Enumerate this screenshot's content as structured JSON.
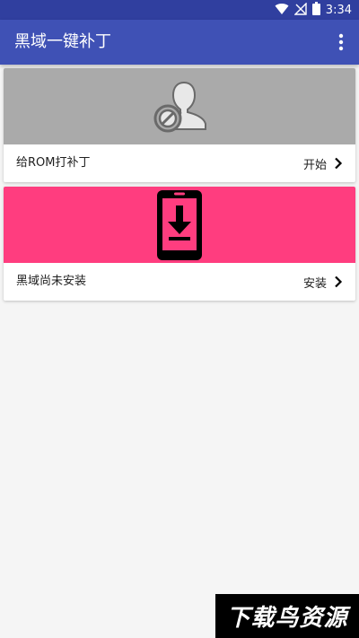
{
  "status_bar": {
    "time": "3:34",
    "icons": [
      "wifi-icon",
      "no-signal-icon",
      "battery-icon"
    ]
  },
  "app_bar": {
    "title": "黑域一键补丁",
    "menu_icon": "more-vert-icon"
  },
  "cards": [
    {
      "banner_color": "#aaaaaa",
      "banner_icon": "user-blocked-icon",
      "label": "给ROM打补丁",
      "action": "开始",
      "action_icon": "chevron-right-icon"
    },
    {
      "banner_color": "#ff3d7f",
      "banner_icon": "phone-download-icon",
      "label": "黑域尚未安装",
      "action": "安装",
      "action_icon": "chevron-right-icon"
    }
  ],
  "watermark": {
    "text": "下载鸟资源"
  },
  "colors": {
    "primary": "#3f51b5",
    "primary_dark": "#303f9f",
    "background": "#f5f5f5"
  }
}
